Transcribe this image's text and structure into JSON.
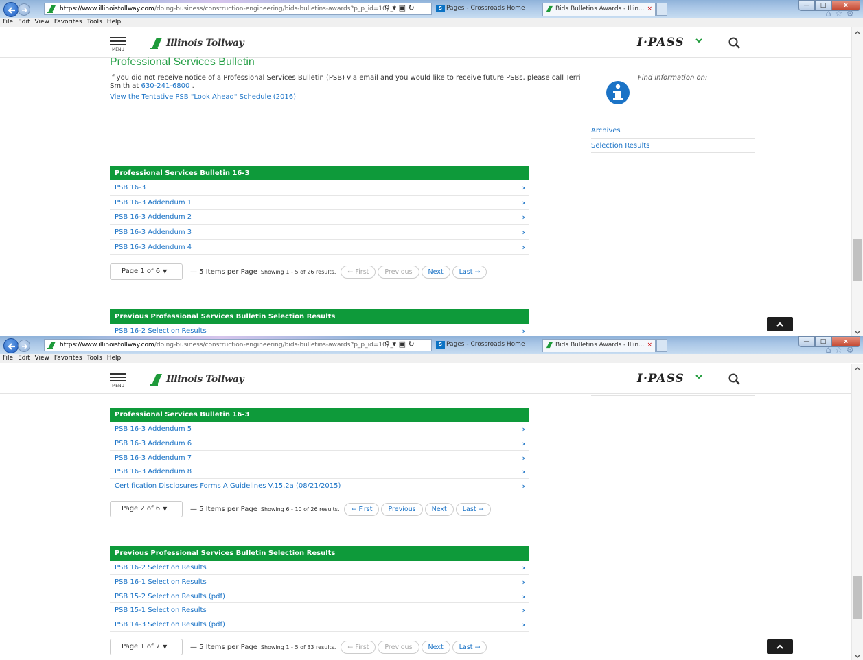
{
  "browser": {
    "url_host": "https://www.illinoistollway.com",
    "url_path": "/doing-business/construction-engineering/bids-bulletins-awards?p_p_id=101_I",
    "tab1_title": "Pages - Crossroads Home",
    "tab2_title": "Bids Bulletins Awards - Illin...",
    "tab_close": "×",
    "menu": [
      "File",
      "Edit",
      "View",
      "Favorites",
      "Tools",
      "Help"
    ],
    "minimize": "—",
    "maximize": "□",
    "close": "x",
    "sp_icon": "S"
  },
  "header": {
    "menu_label": "MENU",
    "logo_text": "Illinois Tollway",
    "ipass": "I·PASS"
  },
  "colors": {
    "accent_green": "#0e9a3a",
    "link_blue": "#1b73c6",
    "title_green": "#2aa14a"
  },
  "screen1": {
    "page_title": "Professional Services Bulletin",
    "intro_text": "If you did not receive notice of a Professional Services Bulletin (PSB) via email and you would like to receive future PSBs, please call Terri Smith at",
    "phone": "630-241-6800",
    "intro_end": " .",
    "lookahead_link": "View the Tentative PSB \"Look Ahead\" Schedule (2016)",
    "info_label": "Find information on:",
    "side_links": [
      "Archives",
      "Selection Results"
    ],
    "panel1": {
      "title": "Professional Services Bulletin 16-3",
      "rows": [
        "PSB 16-3",
        "PSB 16-3 Addendum 1",
        "PSB 16-3 Addendum 2",
        "PSB 16-3 Addendum 3",
        "PSB 16-3 Addendum 4"
      ]
    },
    "pager1": {
      "page": "Page 1 of 6",
      "per_page": "— 5 Items per Page",
      "showing": "Showing 1 - 5 of 26 results.",
      "first": "← First",
      "previous": "Previous",
      "next": "Next",
      "last": "Last →"
    },
    "panel2": {
      "title": "Previous Professional Services Bulletin Selection Results",
      "rows": [
        "PSB 16-2 Selection Results"
      ]
    }
  },
  "screen2": {
    "panel1": {
      "title": "Professional Services Bulletin 16-3",
      "rows": [
        "PSB 16-3 Addendum 5",
        "PSB 16-3 Addendum 6",
        "PSB 16-3 Addendum 7",
        "PSB 16-3 Addendum 8",
        "Certification Disclosures Forms A Guidelines V.15.2a (08/21/2015)"
      ]
    },
    "pager1": {
      "page": "Page 2 of 6",
      "per_page": "— 5 Items per Page",
      "showing": "Showing 6 - 10 of 26 results.",
      "first": "← First",
      "previous": "Previous",
      "next": "Next",
      "last": "Last →"
    },
    "panel2": {
      "title": "Previous Professional Services Bulletin Selection Results",
      "rows": [
        "PSB 16-2 Selection Results",
        "PSB 16-1 Selection Results",
        "PSB 15-2 Selection Results (pdf)",
        "PSB 15-1 Selection Results",
        "PSB 14-3 Selection Results (pdf)"
      ]
    },
    "pager2": {
      "page": "Page 1 of 7",
      "per_page": "— 5 Items per Page",
      "showing": "Showing 1 - 5 of 33 results.",
      "first": "← First",
      "previous": "Previous",
      "next": "Next",
      "last": "Last →"
    }
  },
  "icons": {
    "back": "back-arrow-icon",
    "forward": "forward-arrow-icon",
    "search": "search-icon",
    "info": "info-icon",
    "chevron_right": "chevron-right-icon",
    "scroll_top": "chevron-up-icon"
  },
  "chevron": "›"
}
